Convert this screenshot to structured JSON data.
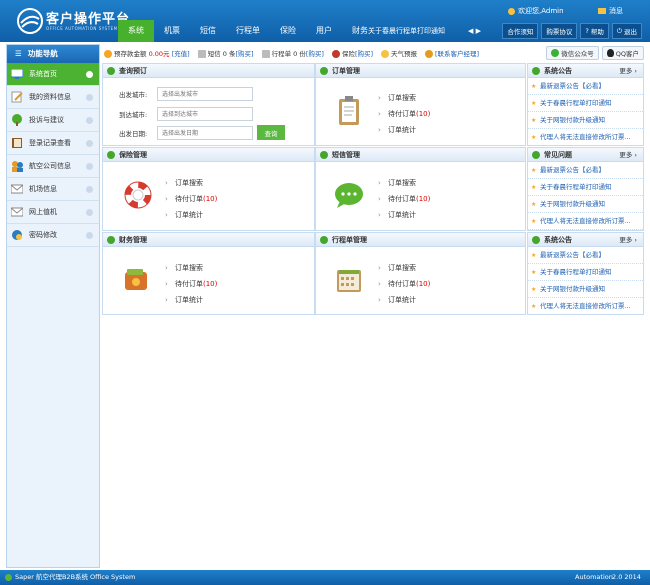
{
  "header": {
    "title": "客户操作平台",
    "subtitle": "OFFICE AUTOMATION SYSTEM",
    "nav": [
      "系统",
      "机票",
      "短信",
      "行程单",
      "保险",
      "用户",
      "财务"
    ],
    "marquee": "关于春晨行程单打印通知",
    "arrows": "◀ ▶",
    "welcome": "欢迎您,Admin",
    "message": "消息",
    "buttons": [
      "合作须知",
      "购票协议",
      "帮助",
      "退出"
    ]
  },
  "sidebar": {
    "title": "功能导航",
    "items": [
      "系统首页",
      "我的资料信息",
      "投诉与建议",
      "登录记录查看",
      "航空公司信息",
      "机场信息",
      "网上值机",
      "密码修改"
    ]
  },
  "infobar": {
    "balance_label": "预存款金额",
    "balance_value": "0.00元",
    "recharge": "[充值]",
    "sms_label": "短信 0 条",
    "sms_buy": "[购买]",
    "itin_label": "行程单 0 份",
    "itin_buy": "[购买]",
    "insurance_label": "保险",
    "insurance_buy": "[购买]",
    "weather": "天气预报",
    "contact": "[联系客户经理]",
    "wechat": "微信公众号",
    "qq": "QQ客户"
  },
  "panels": {
    "query": {
      "title": "查询预订",
      "from_label": "出发城市:",
      "from_ph": "选择出发城市",
      "to_label": "到达城市:",
      "to_ph": "选择到达城市",
      "date_label": "出发日期:",
      "date_ph": "选择出发日期",
      "btn": "查询"
    },
    "order": {
      "title": "订单管理",
      "search": "订单搜索",
      "pending": "待付订单",
      "count": "(10)",
      "stats": "订单统计"
    },
    "ann1": {
      "title": "系统公告",
      "more": "更多 ›",
      "items": [
        "最新退票公告【必看】",
        "关于春晨行程单打印通知",
        "关于网银付款升级通知",
        "代理人将无法直接修改所订票..."
      ]
    },
    "insurance": {
      "title": "保险管理",
      "search": "订单搜索",
      "pending": "待付订单",
      "count": "(10)",
      "stats": "订单统计"
    },
    "sms": {
      "title": "短信管理",
      "search": "订单搜索",
      "pending": "待付订单",
      "count": "(10)",
      "stats": "订单统计"
    },
    "faq": {
      "title": "常见问题",
      "more": "更多 ›",
      "items": [
        "最新退票公告【必看】",
        "关于春晨行程单打印通知",
        "关于网银付款升级通知",
        "代理人将无法直接修改所订票..."
      ]
    },
    "finance": {
      "title": "财务管理",
      "search": "订单搜索",
      "pending": "待付订单",
      "count": "(10)",
      "stats": "订单统计"
    },
    "itinerary": {
      "title": "行程单管理",
      "search": "订单搜索",
      "pending": "待付订单",
      "count": "(10)",
      "stats": "订单统计"
    },
    "ann2": {
      "title": "系统公告",
      "more": "更多 ›",
      "items": [
        "最新退票公告【必看】",
        "关于春晨行程单打印通知",
        "关于网银付款升级通知",
        "代理人将无法直接修改所订票..."
      ]
    }
  },
  "footer": {
    "left": "Saper 航空代理B2B系统",
    "mid": "Office System",
    "right_label": "Automation",
    "version": "2.0 2014"
  },
  "colors": {
    "brand_blue": "#1668b4",
    "accent_green": "#47b12d",
    "alert_red": "#dd0000"
  }
}
